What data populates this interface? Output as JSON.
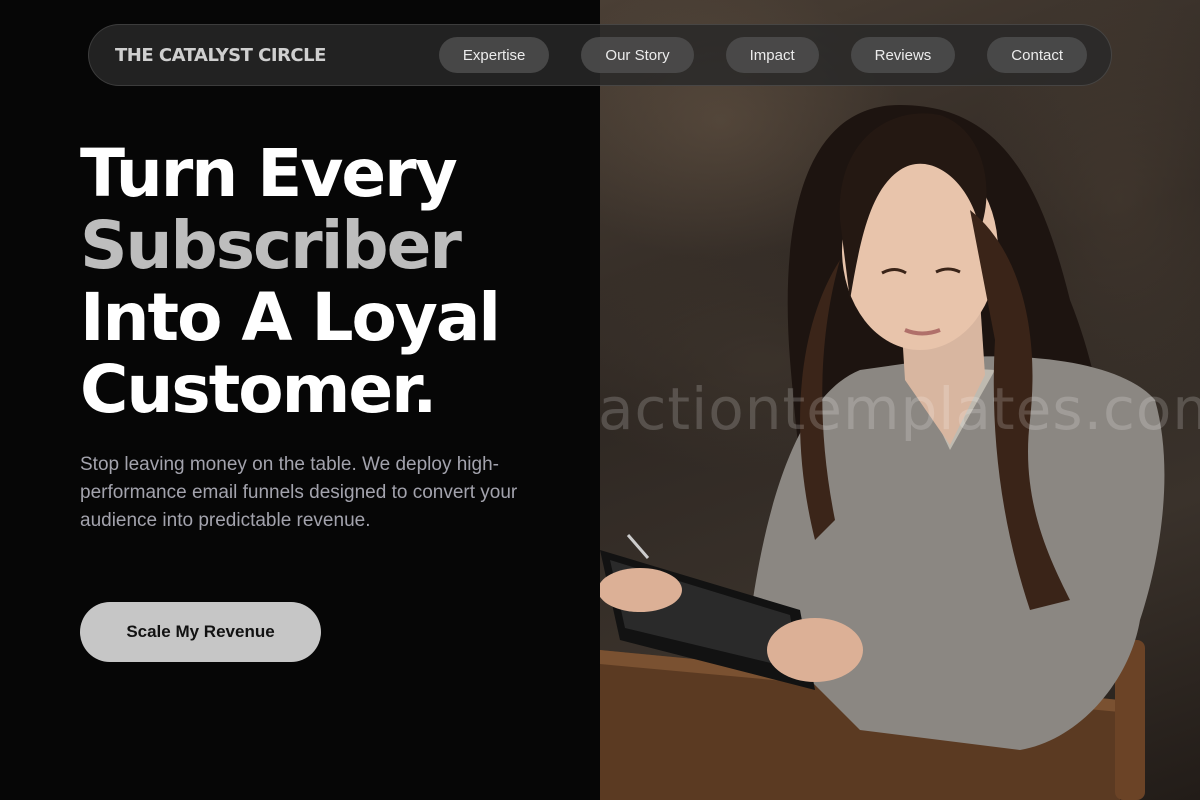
{
  "brand": "THE CATALYST CIRCLE",
  "nav": {
    "items": [
      {
        "label": "Expertise"
      },
      {
        "label": "Our Story"
      },
      {
        "label": "Impact"
      },
      {
        "label": "Reviews"
      },
      {
        "label": "Contact"
      }
    ]
  },
  "hero": {
    "headline": {
      "line1": "Turn Every",
      "line2": "Subscriber",
      "line3": "Into A Loyal",
      "line4": "Customer."
    },
    "subtext": "Stop leaving money on the table. We deploy high-performance email funnels designed to convert your audience into predictable revenue.",
    "cta_label": "Scale My Revenue"
  },
  "photo": {
    "watermark": "actiontemplates.com"
  },
  "colors": {
    "background": "#060606",
    "headline": "#ffffff",
    "headline_accent": "#bdbdbd",
    "subtext": "#a3a3ad",
    "cta_bg": "#c6c6c6",
    "nav_pill": "#4e4e4e"
  }
}
